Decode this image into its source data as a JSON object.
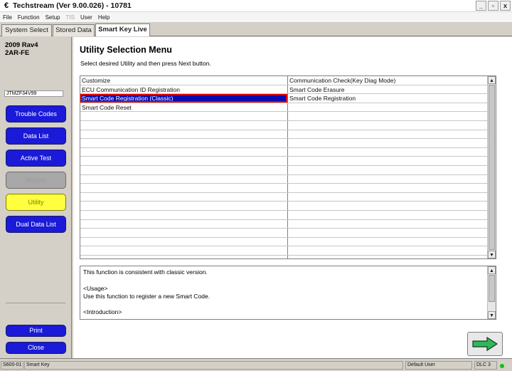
{
  "window": {
    "title": "Techstream (Ver 9.00.026) - 10781",
    "min": "_",
    "max": "▫",
    "close": "x"
  },
  "menubar": [
    "File",
    "Function",
    "Setup",
    "TIS",
    "User",
    "Help"
  ],
  "tabs": [
    "System Select",
    "Stored Data",
    "Smart Key Live"
  ],
  "sidebar": {
    "vehicle_line1": "2009 Rav4",
    "vehicle_line2": "2AR-FE",
    "vin": "JTMZF34V99",
    "buttons": [
      "Trouble Codes",
      "Data List",
      "Active Test",
      "Monitor",
      "Utility",
      "Dual Data List"
    ],
    "print_label": "Print",
    "close_label": "Close"
  },
  "main": {
    "title": "Utility Selection Menu",
    "subtitle": "Select desired Utility and then press Next button.",
    "rows": [
      [
        "Customize",
        "Communication Check(Key Diag Mode)"
      ],
      [
        "ECU Communication ID Registration",
        "Smart Code Erasure"
      ],
      [
        "Smart Code Registration (Classic)",
        "Smart Code Registration"
      ],
      [
        "Smart Code Reset",
        ""
      ]
    ],
    "selected_row": 2,
    "description": [
      "This function is consistent with classic version.",
      "",
      "<Usage>",
      "Use this function to register a new Smart Code.",
      "",
      "<Introduction>"
    ]
  },
  "statusbar": [
    "S600-01",
    "Smart Key",
    "Default User",
    "DLC 3"
  ],
  "colors": {
    "selection": "#0a0ab0",
    "highlight_border": "#e00000",
    "button_blue": "#1a1ad8",
    "utility_yellow": "#ffff40",
    "next_arrow": "#2db85c"
  },
  "icons": {
    "next": "right-arrow-icon",
    "app": "techstream-logo-icon"
  }
}
